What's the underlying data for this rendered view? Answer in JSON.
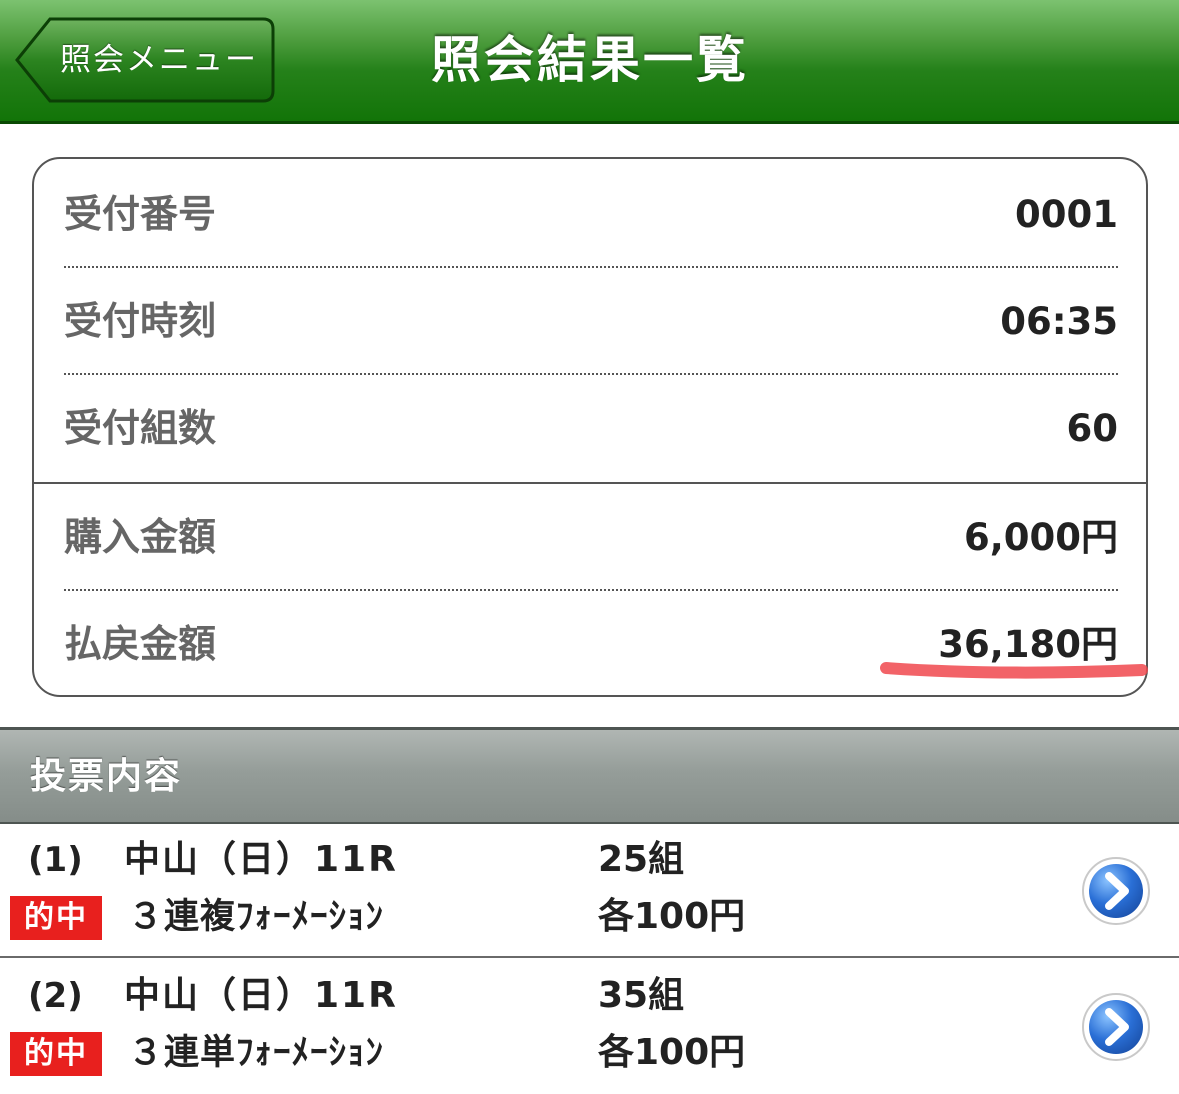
{
  "header": {
    "back_label": "照会メニュー",
    "title": "照会結果一覧"
  },
  "info": {
    "receipt_number": {
      "label": "受付番号",
      "value": "0001"
    },
    "receipt_time": {
      "label": "受付時刻",
      "value": "06:35"
    },
    "receipt_sets": {
      "label": "受付組数",
      "value": "60"
    },
    "purchase_amount": {
      "label": "購入金額",
      "value": "6,000円"
    },
    "payout_amount": {
      "label": "払戻金額",
      "value": "36,180円"
    }
  },
  "section": {
    "title": "投票内容"
  },
  "bets": [
    {
      "number": "(1)",
      "race": "中山（日）11R",
      "sets": "25組",
      "badge": "的中",
      "bet_type": "３連複ﾌｫｰﾒｰｼｮﾝ",
      "unit": "各100円"
    },
    {
      "number": "(2)",
      "race": "中山（日）11R",
      "sets": "35組",
      "badge": "的中",
      "bet_type": "３連単ﾌｫｰﾒｰｼｮﾝ",
      "unit": "各100円"
    }
  ],
  "colors": {
    "header_green": "#25811a",
    "hit_badge_red": "#e8201e",
    "detail_button_blue": "#2a6fd6",
    "highlight_red": "#f0484e"
  }
}
